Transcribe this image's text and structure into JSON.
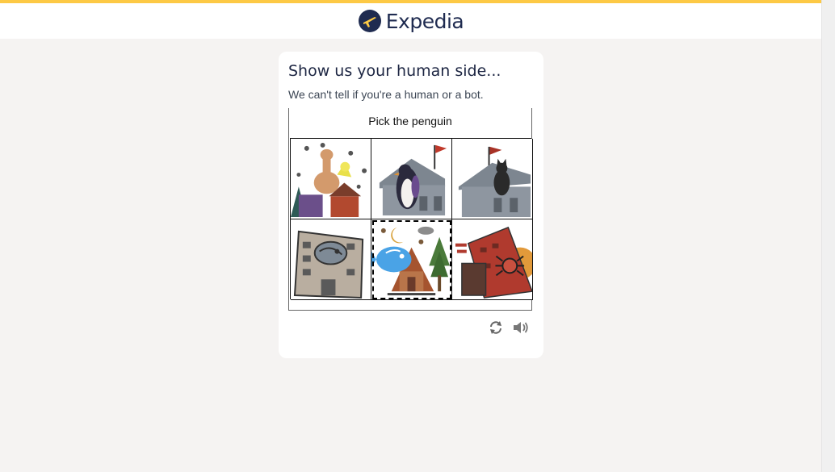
{
  "header": {
    "brand": "Expedia",
    "accent_color": "#fdc945",
    "logo_color": "#1f2b50"
  },
  "card": {
    "title": "Show us your human side...",
    "subtitle": "We can't tell if you're a human or a bot."
  },
  "challenge": {
    "prompt": "Pick the penguin",
    "tiles": [
      {
        "icon": "llama-bird-village-icon",
        "selected": false
      },
      {
        "icon": "penguin-house-flag-icon",
        "selected": false
      },
      {
        "icon": "cat-house-flag-icon",
        "selected": false
      },
      {
        "icon": "creature-office-building-icon",
        "selected": false
      },
      {
        "icon": "fish-cabin-forest-icon",
        "selected": true
      },
      {
        "icon": "spider-red-building-icon",
        "selected": false
      }
    ]
  },
  "controls": {
    "refresh_icon": "refresh-icon",
    "audio_icon": "speaker-icon"
  }
}
